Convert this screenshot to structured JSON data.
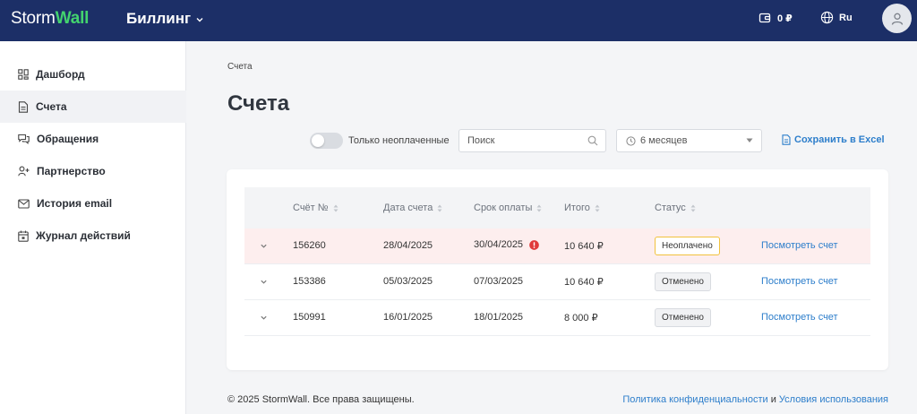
{
  "header": {
    "logo_storm": "Storm",
    "logo_wall": "Wall",
    "section": "Биллинг",
    "balance": "0 ₽",
    "language": "Ru"
  },
  "sidebar": {
    "items": [
      {
        "label": "Дашборд",
        "icon": "dashboard-icon"
      },
      {
        "label": "Счета",
        "icon": "invoice-icon",
        "active": true
      },
      {
        "label": "Обращения",
        "icon": "chat-icon"
      },
      {
        "label": "Партнерство",
        "icon": "partners-icon"
      },
      {
        "label": "История email",
        "icon": "mail-icon"
      },
      {
        "label": "Журнал действий",
        "icon": "calendar-icon"
      }
    ]
  },
  "main": {
    "breadcrumb": "Счета",
    "title": "Счета",
    "filters": {
      "unpaid_only_label": "Только неоплаченные",
      "search_placeholder": "Поиск",
      "period_value": "6 месяцев",
      "export_label": "Сохранить в Excel"
    },
    "table": {
      "columns": [
        "Счёт №",
        "Дата счета",
        "Срок оплаты",
        "Итого",
        "Статус"
      ],
      "rows": [
        {
          "number": "156260",
          "date": "28/04/2025",
          "due": "30/04/2025",
          "total": "10 640 ₽",
          "status": "Неоплачено",
          "status_type": "unpaid",
          "overdue": true,
          "action": "Посмотреть счет"
        },
        {
          "number": "153386",
          "date": "05/03/2025",
          "due": "07/03/2025",
          "total": "10 640 ₽",
          "status": "Отменено",
          "status_type": "cancelled",
          "overdue": false,
          "action": "Посмотреть счет"
        },
        {
          "number": "150991",
          "date": "16/01/2025",
          "due": "18/01/2025",
          "total": "8 000 ₽",
          "status": "Отменено",
          "status_type": "cancelled",
          "overdue": false,
          "action": "Посмотреть счет"
        }
      ]
    }
  },
  "footer": {
    "copyright": "© 2025 StormWall. Все права защищены.",
    "privacy": "Политика конфиденциальности",
    "and": " и ",
    "terms": "Условия использования"
  },
  "colors": {
    "header_bg": "#1c2f67",
    "brand_green": "#43d36e",
    "link_blue": "#2d7ecb",
    "unpaid_row_bg": "#fdeeee",
    "unpaid_badge_border": "#f1c23d",
    "overdue_red": "#e03b3b"
  }
}
